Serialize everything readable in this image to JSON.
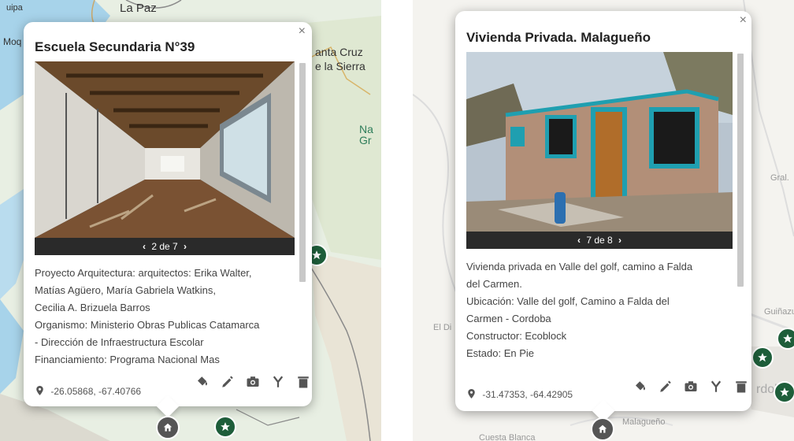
{
  "left": {
    "map_labels": {
      "top_city": "La Paz",
      "side_left": "Moq",
      "city_right_1": "anta Cruz",
      "city_right_2": "e la Sierra",
      "region_right_1": "Na",
      "region_right_2": "Gr",
      "top_left": "uipa"
    },
    "popup": {
      "title": "Escuela Secundaria N°39",
      "close": "×",
      "photo_index": "2 de 7",
      "description_lines": [
        "Proyecto Arquitectura: arquitectos: Erika Walter,",
        "Matías Agüero, María Gabriela Watkins,",
        "Cecilia A. Brizuela Barros",
        "Organismo: Ministerio Obras Publicas Catamarca",
        "- Dirección de Infraestructura Escolar",
        "Financiamiento: Programa Nacional Mas"
      ],
      "coords": "-26.05868, -67.40766"
    }
  },
  "right": {
    "map_labels": {
      "west": "El Di",
      "east_1": "Gral.",
      "east_2": "Guiñazu",
      "city": "rdob",
      "south_1": "Malagueño",
      "south_2": "Cuesta Blanca"
    },
    "popup": {
      "title": "Vivienda Privada. Malagueño",
      "close": "×",
      "photo_index": "7 de 8",
      "description_lines": [
        "Vivienda privada en Valle del golf, camino a Falda",
        "del Carmen.",
        "Ubicación: Valle del golf, Camino a Falda del",
        "Carmen - Cordoba",
        "Constructor: Ecoblock",
        "Estado: En Pie"
      ],
      "coords": "-31.47353, -64.42905"
    }
  },
  "icons": [
    "paint-bucket-icon",
    "pencil-icon",
    "camera-icon",
    "merge-icon",
    "trash-icon",
    "map-pin-icon",
    "home-icon",
    "star-icon"
  ],
  "colors": {
    "marker_green": "#1e5e3a",
    "map_water": "#9fd0e8",
    "map_land": "#f2efe9"
  }
}
